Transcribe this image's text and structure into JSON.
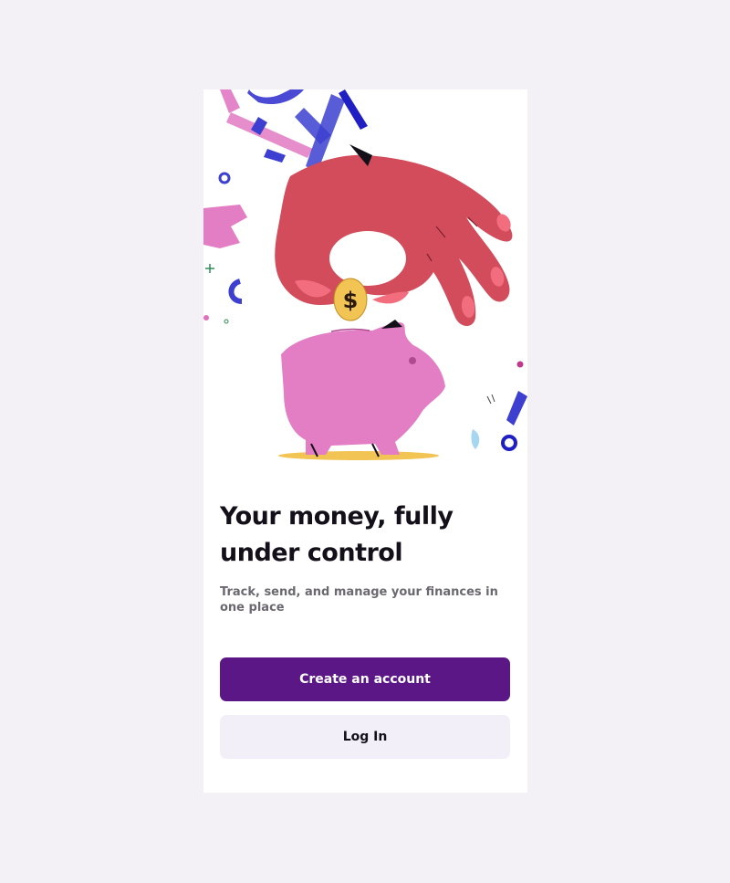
{
  "onboarding": {
    "headline": "Your money, fully under control",
    "subtitle": "Track, send, and manage your finances in one place",
    "create_account_label": "Create an account",
    "login_label": "Log In",
    "coin_symbol": "$"
  },
  "colors": {
    "page_background": "#f3f1f5",
    "primary_button": "#5b1786",
    "secondary_button": "#f3eff8",
    "hand": "#d24c5b",
    "piggy_bank": "#e47ec4",
    "coin": "#f1c453",
    "confetti_blue": "#3c3fd0",
    "confetti_pink": "#e070bf"
  },
  "icons": {
    "hero": "hand-dropping-coin-into-piggy-bank-illustration"
  }
}
